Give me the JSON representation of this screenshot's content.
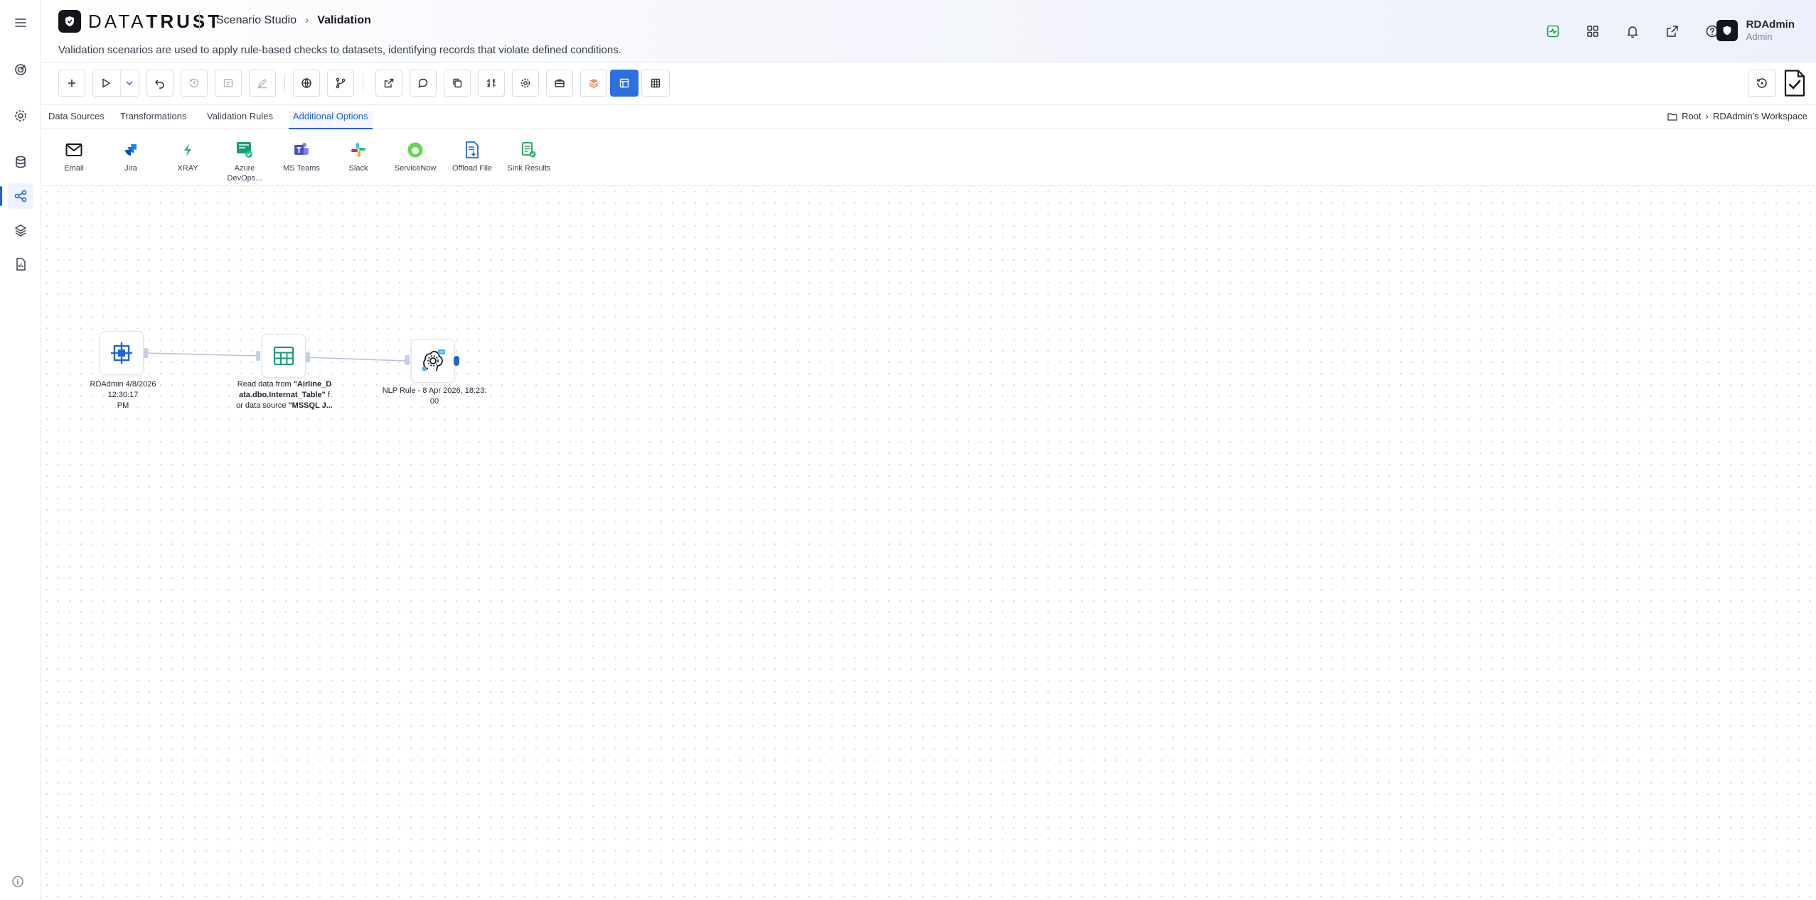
{
  "app": {
    "brand_light": "DATA",
    "brand_bold": "TRUST",
    "breadcrumb_root": "Scenario Studio",
    "breadcrumb_current": "Validation",
    "description": "Validation scenarios are used to apply rule-based checks to datasets, identifying records that violate defined conditions."
  },
  "user": {
    "name": "RDAdmin",
    "role": "Admin"
  },
  "tabs": [
    {
      "label": "Data Sources"
    },
    {
      "label": "Transformations"
    },
    {
      "label": "Validation Rules"
    },
    {
      "label": "Additional Options"
    }
  ],
  "workspace_path": {
    "root": "Root",
    "workspace": "RDAdmin's Workspace"
  },
  "palette": [
    {
      "label": "Email"
    },
    {
      "label": "Jira"
    },
    {
      "label": "XRAY"
    },
    {
      "label": "Azure DevOps..."
    },
    {
      "label": "MS Teams"
    },
    {
      "label": "Slack"
    },
    {
      "label": "ServiceNow"
    },
    {
      "label": "Offload File"
    },
    {
      "label": "Sink Results"
    }
  ],
  "nodes": {
    "start": {
      "label_line1": "RDAdmin 4/8/2026 12:30:17",
      "label_line2": "PM"
    },
    "read": {
      "l1_prefix": "Read data from ",
      "l1_bold": "\"Airline_D",
      "l2_bold": "ata.dbo.Internat_Table\"",
      "l2_suffix": " f",
      "l3_prefix": "or data source ",
      "l3_bold": "\"MSSQL J..."
    },
    "nlp": {
      "label_line1": "NLP Rule - 8 Apr 2026, 18:23:",
      "label_line2": "00"
    }
  },
  "colors": {
    "accent": "#1f64d8",
    "active_button": "#2b6fe0",
    "health_green": "#1f9d55"
  }
}
